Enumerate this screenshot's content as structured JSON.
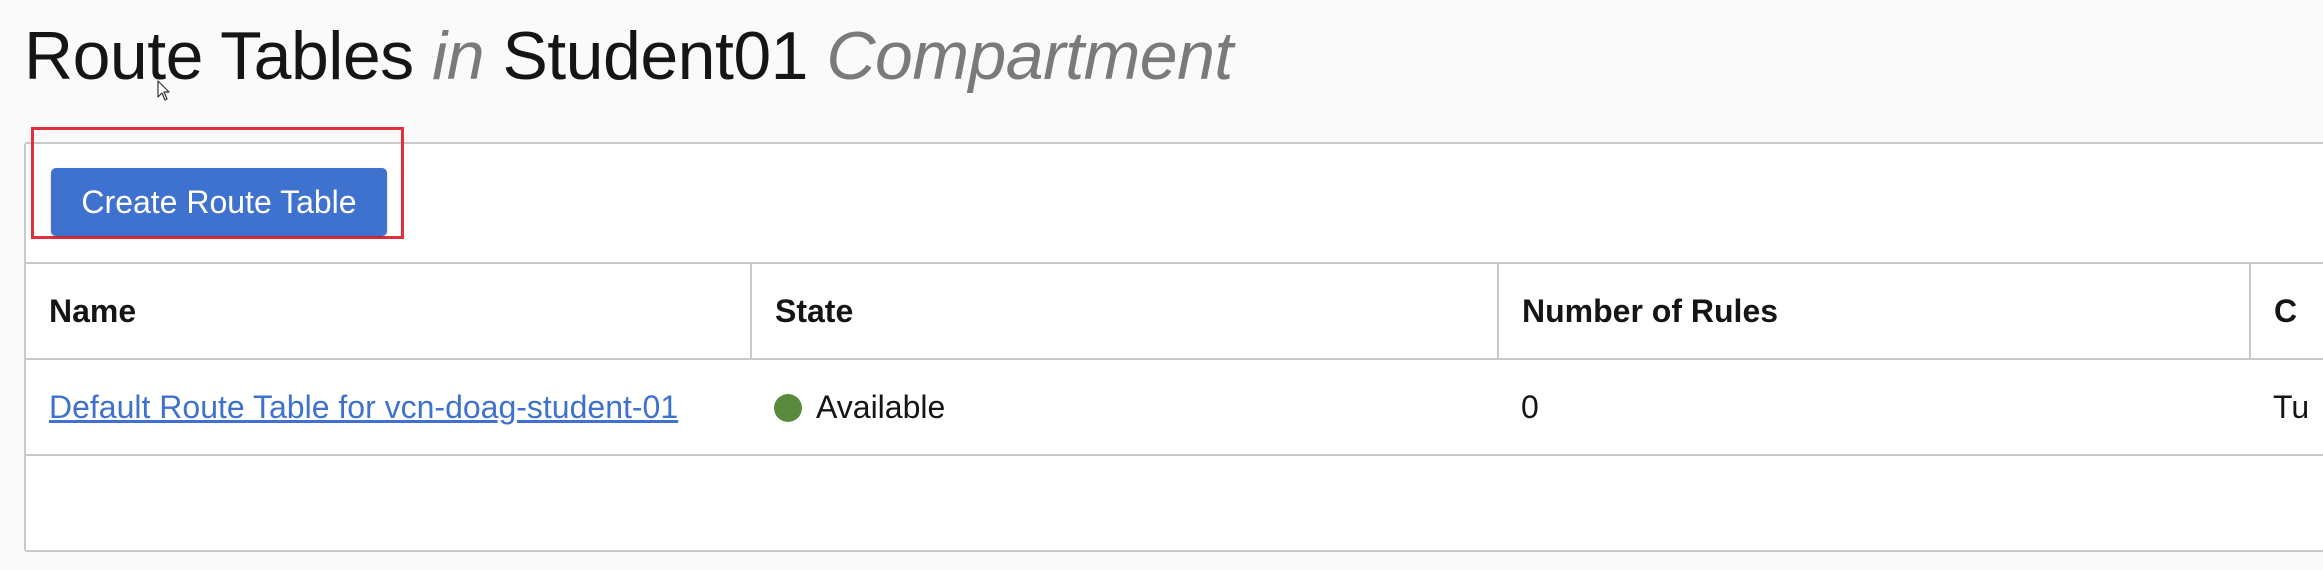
{
  "header": {
    "title_resource": "Route Tables",
    "title_in": "in",
    "title_compartment_name": "Student01",
    "title_compartment_word": "Compartment"
  },
  "toolbar": {
    "create_label": "Create Route Table",
    "highlight_color": "#e0303d",
    "button_color": "#3f72cf"
  },
  "table": {
    "columns": [
      "Name",
      "State",
      "Number of Rules",
      "C"
    ],
    "rows": [
      {
        "name": "Default Route Table for vcn-doag-student-01",
        "state": "Available",
        "state_color": "#5a8a3c",
        "rules": "0",
        "created": "Tu"
      }
    ]
  }
}
